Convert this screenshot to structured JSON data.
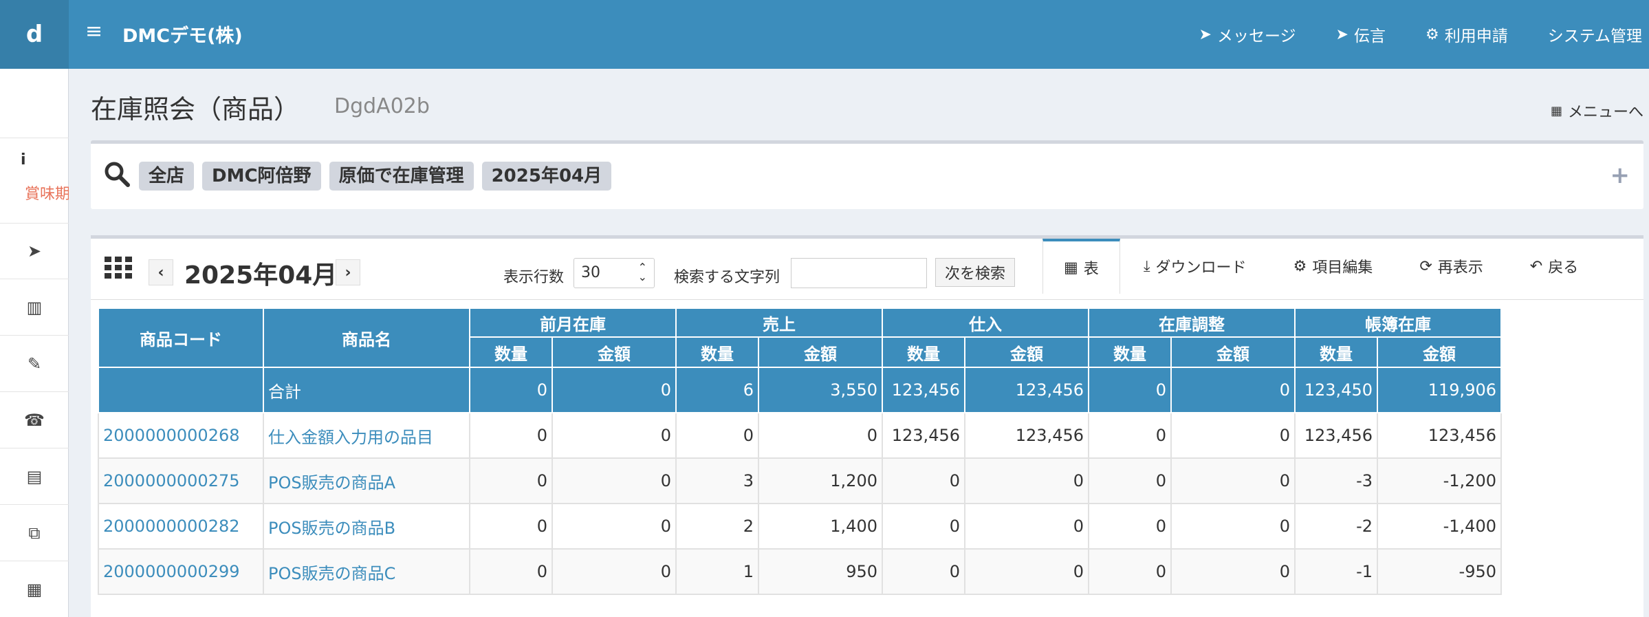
{
  "header": {
    "logo": "d",
    "menu_icon": "≡",
    "company": "DMCデモ(株)",
    "nav": [
      {
        "icon": "paper-plane-icon",
        "glyph": "➤",
        "label": "メッセージ"
      },
      {
        "icon": "paper-plane-icon",
        "glyph": "➤",
        "label": "伝言"
      },
      {
        "icon": "gear-icon",
        "glyph": "⚙",
        "label": "利用申請"
      },
      {
        "icon": "",
        "glyph": "",
        "label": "システム管理"
      }
    ]
  },
  "sidebar": {
    "info_icon": "i",
    "info_text": "賞味期",
    "items": [
      {
        "icon": "paper-plane-icon",
        "glyph": "➤"
      },
      {
        "icon": "bar-chart-icon",
        "glyph": "▥"
      },
      {
        "icon": "edit-icon",
        "glyph": "✎"
      },
      {
        "icon": "fax-icon",
        "glyph": "☎"
      },
      {
        "icon": "document-icon",
        "glyph": "▤"
      },
      {
        "icon": "cubes-icon",
        "glyph": "⧉"
      },
      {
        "icon": "calendar-icon",
        "glyph": "▦"
      }
    ]
  },
  "page": {
    "title": "在庫照会（商品）",
    "code": "DgdA02b",
    "menu_link": "メニューへ"
  },
  "search": {
    "tags": [
      "全店",
      "DMC阿倍野",
      "原価で在庫管理",
      "2025年04月"
    ],
    "expand": "+"
  },
  "toolbar": {
    "month": "2025年04月",
    "prev": "‹",
    "next": "›",
    "rows_label": "表示行数",
    "rows_value": "30",
    "search_label": "検索する文字列",
    "search_value": "",
    "next_search": "次を検索",
    "tabs": [
      {
        "icon": "grid-icon",
        "glyph": "▦",
        "label": "表"
      },
      {
        "icon": "download-icon",
        "glyph": "⤓",
        "label": "ダウンロード"
      },
      {
        "icon": "gear-icon",
        "glyph": "⚙",
        "label": "項目編集"
      },
      {
        "icon": "refresh-icon",
        "glyph": "⟳",
        "label": "再表示"
      },
      {
        "icon": "reply-icon",
        "glyph": "↶",
        "label": "戻る"
      }
    ]
  },
  "table": {
    "col_code": "商品コード",
    "col_name": "商品名",
    "groups": [
      "前月在庫",
      "売上",
      "仕入",
      "在庫調整",
      "帳簿在庫"
    ],
    "sub": [
      "数量",
      "金額"
    ],
    "total": {
      "label": "合計",
      "values": [
        "0",
        "0",
        "6",
        "3,550",
        "123,456",
        "123,456",
        "0",
        "0",
        "123,450",
        "119,906"
      ]
    },
    "rows": [
      {
        "code": "2000000000268",
        "name": "仕入金額入力用の品目",
        "values": [
          "0",
          "0",
          "0",
          "0",
          "123,456",
          "123,456",
          "0",
          "0",
          "123,456",
          "123,456"
        ]
      },
      {
        "code": "2000000000275",
        "name": "POS販売の商品A",
        "values": [
          "0",
          "0",
          "3",
          "1,200",
          "0",
          "0",
          "0",
          "0",
          "-3",
          "-1,200"
        ]
      },
      {
        "code": "2000000000282",
        "name": "POS販売の商品B",
        "values": [
          "0",
          "0",
          "2",
          "1,400",
          "0",
          "0",
          "0",
          "0",
          "-2",
          "-1,400"
        ]
      },
      {
        "code": "2000000000299",
        "name": "POS販売の商品C",
        "values": [
          "0",
          "0",
          "1",
          "950",
          "0",
          "0",
          "0",
          "0",
          "-1",
          "-950"
        ]
      }
    ]
  }
}
